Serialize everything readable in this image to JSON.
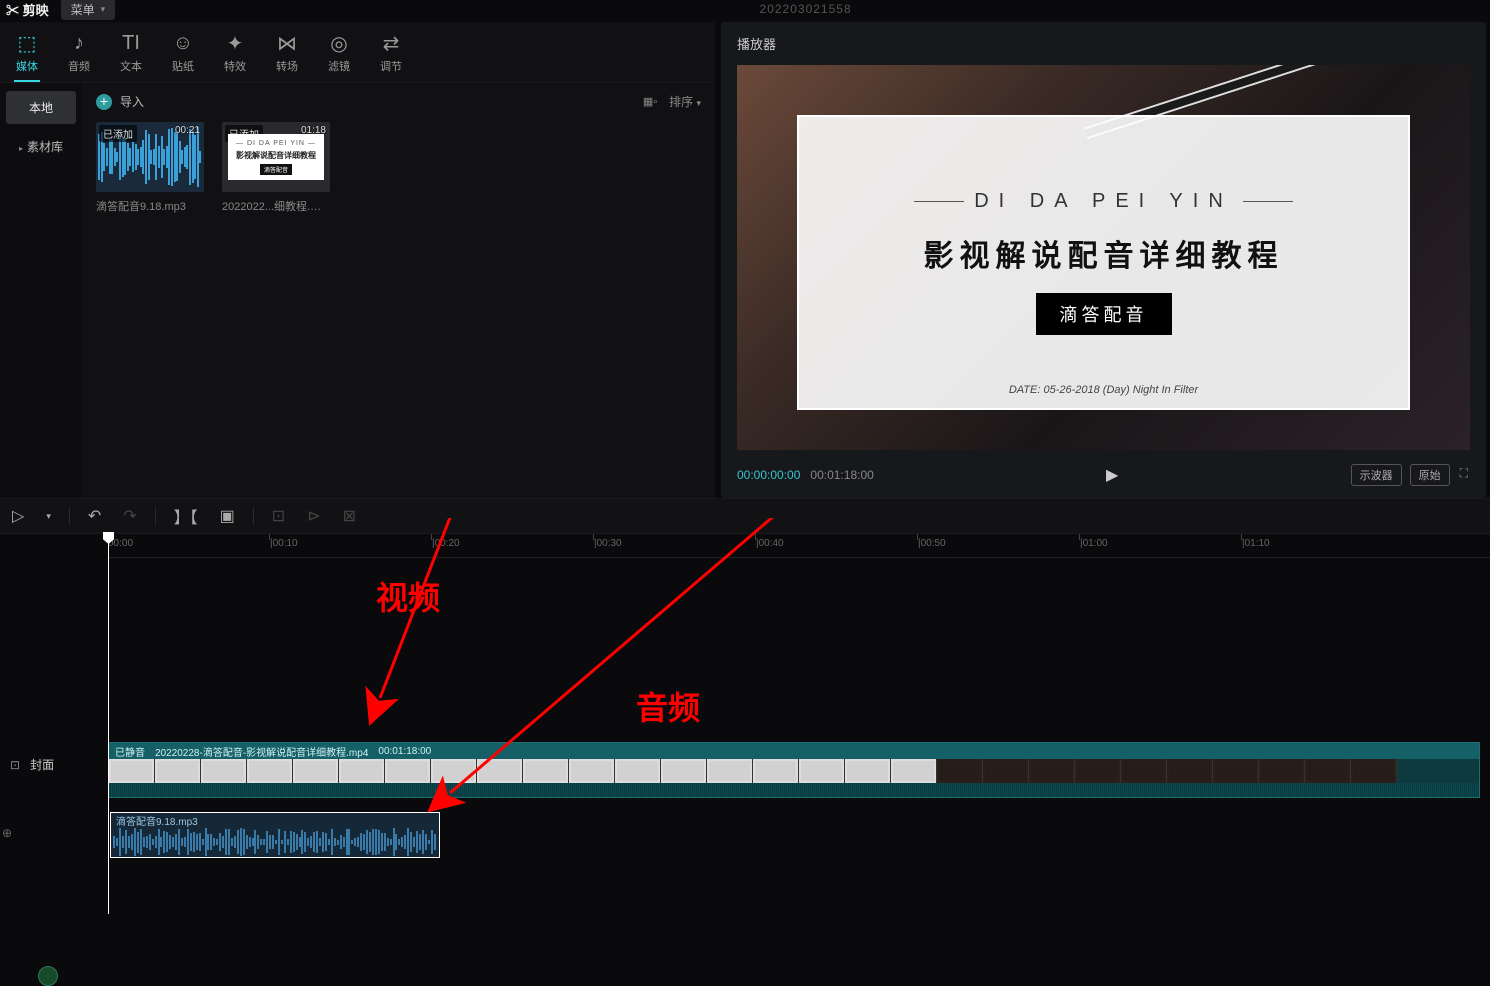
{
  "titlebar": {
    "logo": "✂ 剪映",
    "menu": "菜单",
    "project": "202203021558"
  },
  "topTabs": [
    {
      "icon": "⬚",
      "label": "媒体"
    },
    {
      "icon": "♪",
      "label": "音频"
    },
    {
      "icon": "TI",
      "label": "文本"
    },
    {
      "icon": "☺",
      "label": "贴纸"
    },
    {
      "icon": "✦",
      "label": "特效"
    },
    {
      "icon": "⋈",
      "label": "转场"
    },
    {
      "icon": "◎",
      "label": "滤镜"
    },
    {
      "icon": "⇄",
      "label": "调节"
    }
  ],
  "sideTabs": {
    "local": "本地",
    "library": "素材库"
  },
  "mediaToolbar": {
    "import": "导入",
    "sort": "排序"
  },
  "mediaItems": [
    {
      "badge": "已添加",
      "duration": "00:21",
      "name": "滴答配音9.18.mp3",
      "type": "audio"
    },
    {
      "badge": "已添加",
      "duration": "01:18",
      "name": "2022022...细教程.mp4",
      "type": "video"
    }
  ],
  "player": {
    "title": "播放器",
    "frame": {
      "pinyin": "DI DA PEI YIN",
      "heading": "影视解说配音详细教程",
      "pill": "滴答配音",
      "date": "DATE: 05-26-2018   (Day) Night In Filter"
    },
    "timeCur": "00:00:00:00",
    "timeDur": "00:01:18:00",
    "scope": "示波器",
    "orig": "原始"
  },
  "ruler": [
    "00:00",
    "|00:10",
    "|00:20",
    "|00:30",
    "|00:40",
    "|00:50",
    "|01:00",
    "|01:10"
  ],
  "videoTrack": {
    "muted": "已静音",
    "clipName": "20220228-滴答配音-影视解说配音详细教程.mp4",
    "clipDur": "00:01:18:00"
  },
  "audioTrack": {
    "clipName": "滴答配音9.18.mp3"
  },
  "trackControls": {
    "cover": "封面"
  },
  "annotations": {
    "video": "视频",
    "audio": "音频"
  }
}
